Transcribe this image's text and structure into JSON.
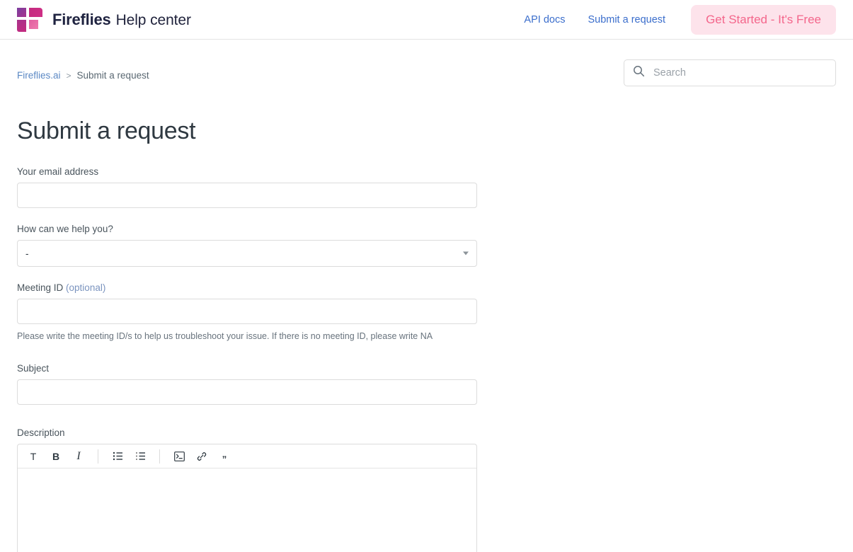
{
  "header": {
    "logo_icon": "fireflies-logo-icon",
    "brand_name": "Fireflies",
    "brand_sub": "Help center",
    "nav": [
      {
        "label": "API docs",
        "name": "api-docs"
      },
      {
        "label": "Submit a request",
        "name": "submit-a-request"
      }
    ],
    "cta_label": "Get Started - It's Free",
    "cta_bg": "#fde3eb",
    "cta_color": "#f4668b"
  },
  "breadcrumb": {
    "home": "Fireflies.ai",
    "separator": ">",
    "current": "Submit a request"
  },
  "search": {
    "icon": "search-icon",
    "placeholder": "Search",
    "value": ""
  },
  "page": {
    "title": "Submit a request"
  },
  "form": {
    "email": {
      "label": "Your email address",
      "value": "",
      "placeholder": ""
    },
    "help_topic": {
      "label": "How can we help you?",
      "selected": "-",
      "arrow_icon": "chevron-down-icon"
    },
    "meeting_id": {
      "label": "Meeting ID",
      "optional_suffix": "(optional)",
      "value": "",
      "placeholder": "",
      "hint": "Please write the meeting ID/s to help us troubleshoot your issue. If there is no meeting ID, please write NA"
    },
    "subject": {
      "label": "Subject",
      "value": "",
      "placeholder": ""
    },
    "description": {
      "label": "Description",
      "value": "",
      "toolbar": [
        {
          "name": "text-style-icon",
          "glyph": "T",
          "style": "t-plain"
        },
        {
          "name": "bold-icon",
          "glyph": "B",
          "style": "t-bold"
        },
        {
          "name": "italic-icon",
          "glyph": "I",
          "style": "t-italic"
        },
        {
          "name": "bulleted-list-icon",
          "glyph": "",
          "style": "svg"
        },
        {
          "name": "numbered-list-icon",
          "glyph": "",
          "style": "svg"
        },
        {
          "name": "code-block-icon",
          "glyph": "",
          "style": "svg"
        },
        {
          "name": "link-icon",
          "glyph": "",
          "style": "svg"
        },
        {
          "name": "blockquote-icon",
          "glyph": "\"",
          "style": "quote"
        }
      ]
    }
  }
}
